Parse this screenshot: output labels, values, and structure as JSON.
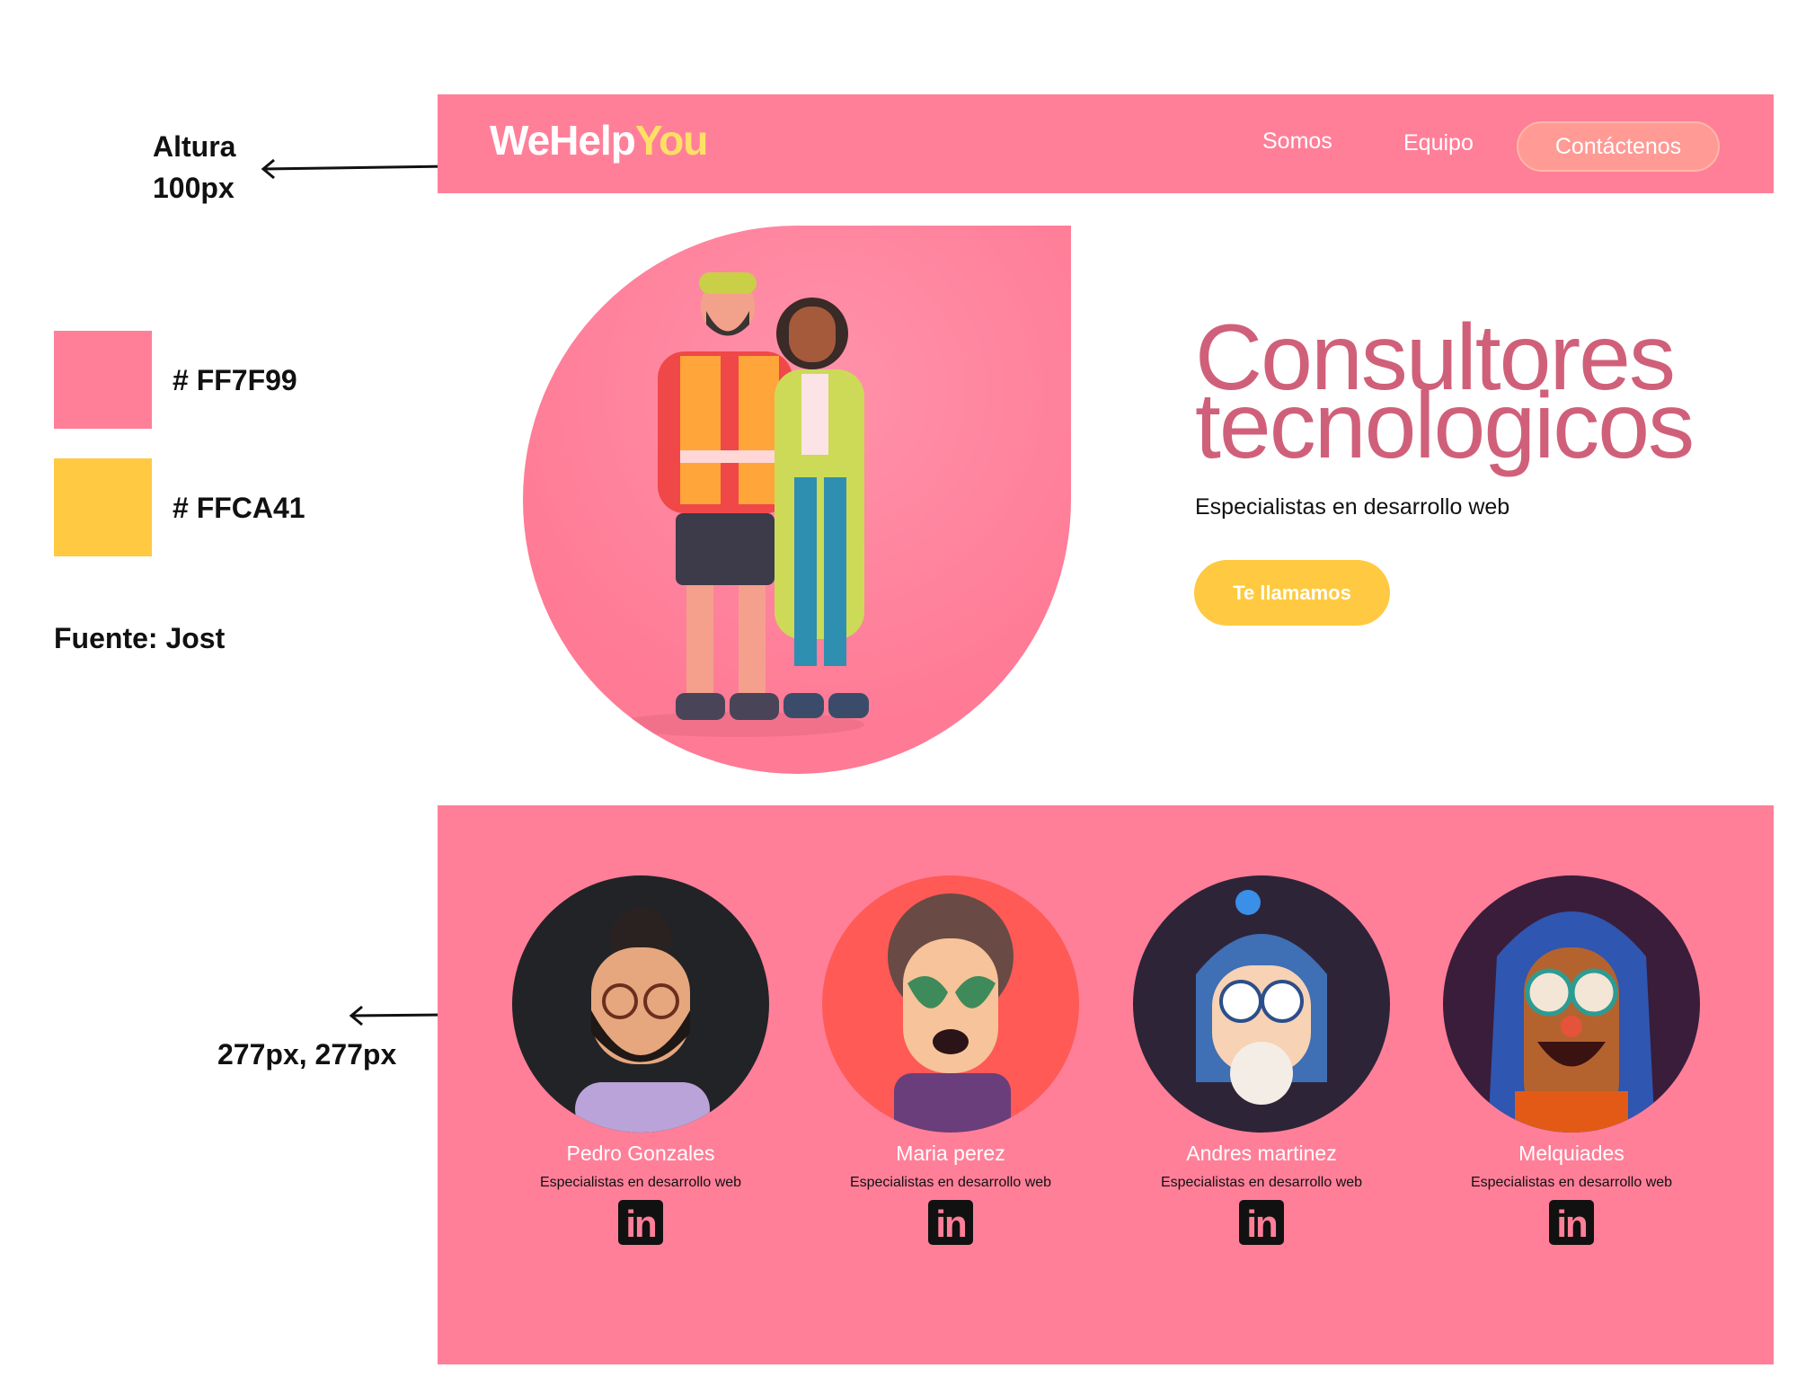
{
  "annotations": {
    "height_label_1": "Altura",
    "height_label_2": "100px",
    "color_primary": "# FF7F99",
    "color_secondary": "# FFCA41",
    "font_label": "Fuente: Jost",
    "avatar_size_label": "277px, 277px"
  },
  "colors": {
    "primary": "#FF7F99",
    "secondary": "#FFCA41"
  },
  "nav": {
    "logo_part1": "WeHelp",
    "logo_part2": "You",
    "links": [
      "Somos",
      "Equipo"
    ],
    "cta": "Contáctenos"
  },
  "hero": {
    "title_line1": "Consultores",
    "title_line2": "tecnologicos",
    "subtitle": "Especialistas en desarrollo web",
    "button": "Te llamamos"
  },
  "team": [
    {
      "name": "Pedro Gonzales",
      "role": "Especialistas en desarrollo web",
      "icon": "linkedin-icon",
      "bg": "#222326"
    },
    {
      "name": "Maria perez",
      "role": "Especialistas en desarrollo web",
      "icon": "linkedin-icon",
      "bg": "#FF5A55"
    },
    {
      "name": "Andres martinez",
      "role": "Especialistas en desarrollo web",
      "icon": "linkedin-icon",
      "bg": "#2E2438"
    },
    {
      "name": "Melquiades",
      "role": "Especialistas en desarrollo web",
      "icon": "linkedin-icon",
      "bg": "#3A1D3A"
    }
  ],
  "linkedin_glyph": "in"
}
